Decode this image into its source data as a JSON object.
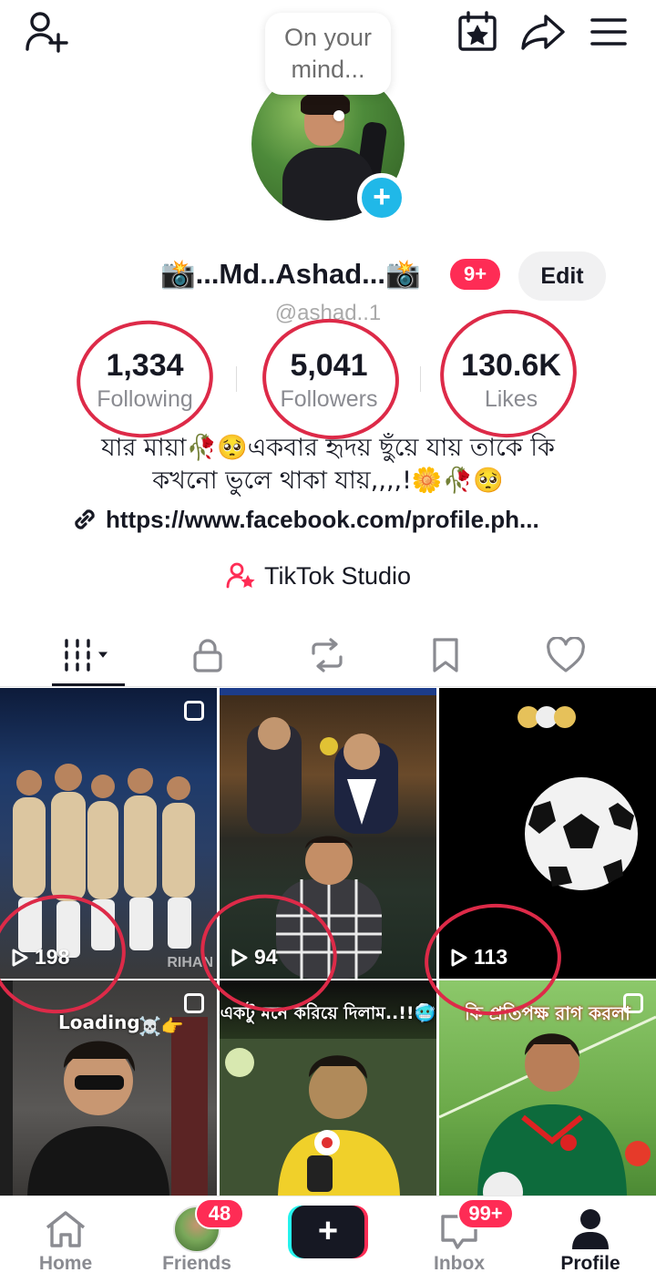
{
  "bubble": {
    "text": "On your mind..."
  },
  "profile": {
    "display_name": "📸...Md..Ashad...📸",
    "notification_count": "9+",
    "edit_label": "Edit",
    "username": "@ashad..1"
  },
  "stats": {
    "following": {
      "value": "1,334",
      "label": "Following"
    },
    "followers": {
      "value": "5,041",
      "label": "Followers"
    },
    "likes": {
      "value": "130.6K",
      "label": "Likes"
    }
  },
  "bio": {
    "line1": "যার মায়া🥀🥺একবার হৃদয় ছুঁয়ে যায় তাকে কি",
    "line2": "কখনো ভুলে থাকা যায়,,,,!🌼🥀🥺",
    "link": "https://www.facebook.com/profile.ph..."
  },
  "studio": {
    "label": "TikTok Studio"
  },
  "videos": [
    {
      "views": "198",
      "watermark": "RIHAN"
    },
    {
      "views": "94"
    },
    {
      "views": "113"
    },
    {
      "caption": "Loading",
      "emoji": "☠️👉"
    },
    {
      "caption": "একটু মনে করিয়ে দিলাম..!!🥶"
    },
    {
      "caption": "কি প্রতিপক্ষ রাগ করলা"
    }
  ],
  "nav": {
    "home": "Home",
    "friends": "Friends",
    "friends_badge": "48",
    "inbox": "Inbox",
    "inbox_badge": "99+",
    "profile": "Profile"
  },
  "colors": {
    "accent": "#fe2c55",
    "cyan": "#25f4ee",
    "plus_blue": "#20b8e8",
    "annotation_red": "#dd2a48"
  }
}
